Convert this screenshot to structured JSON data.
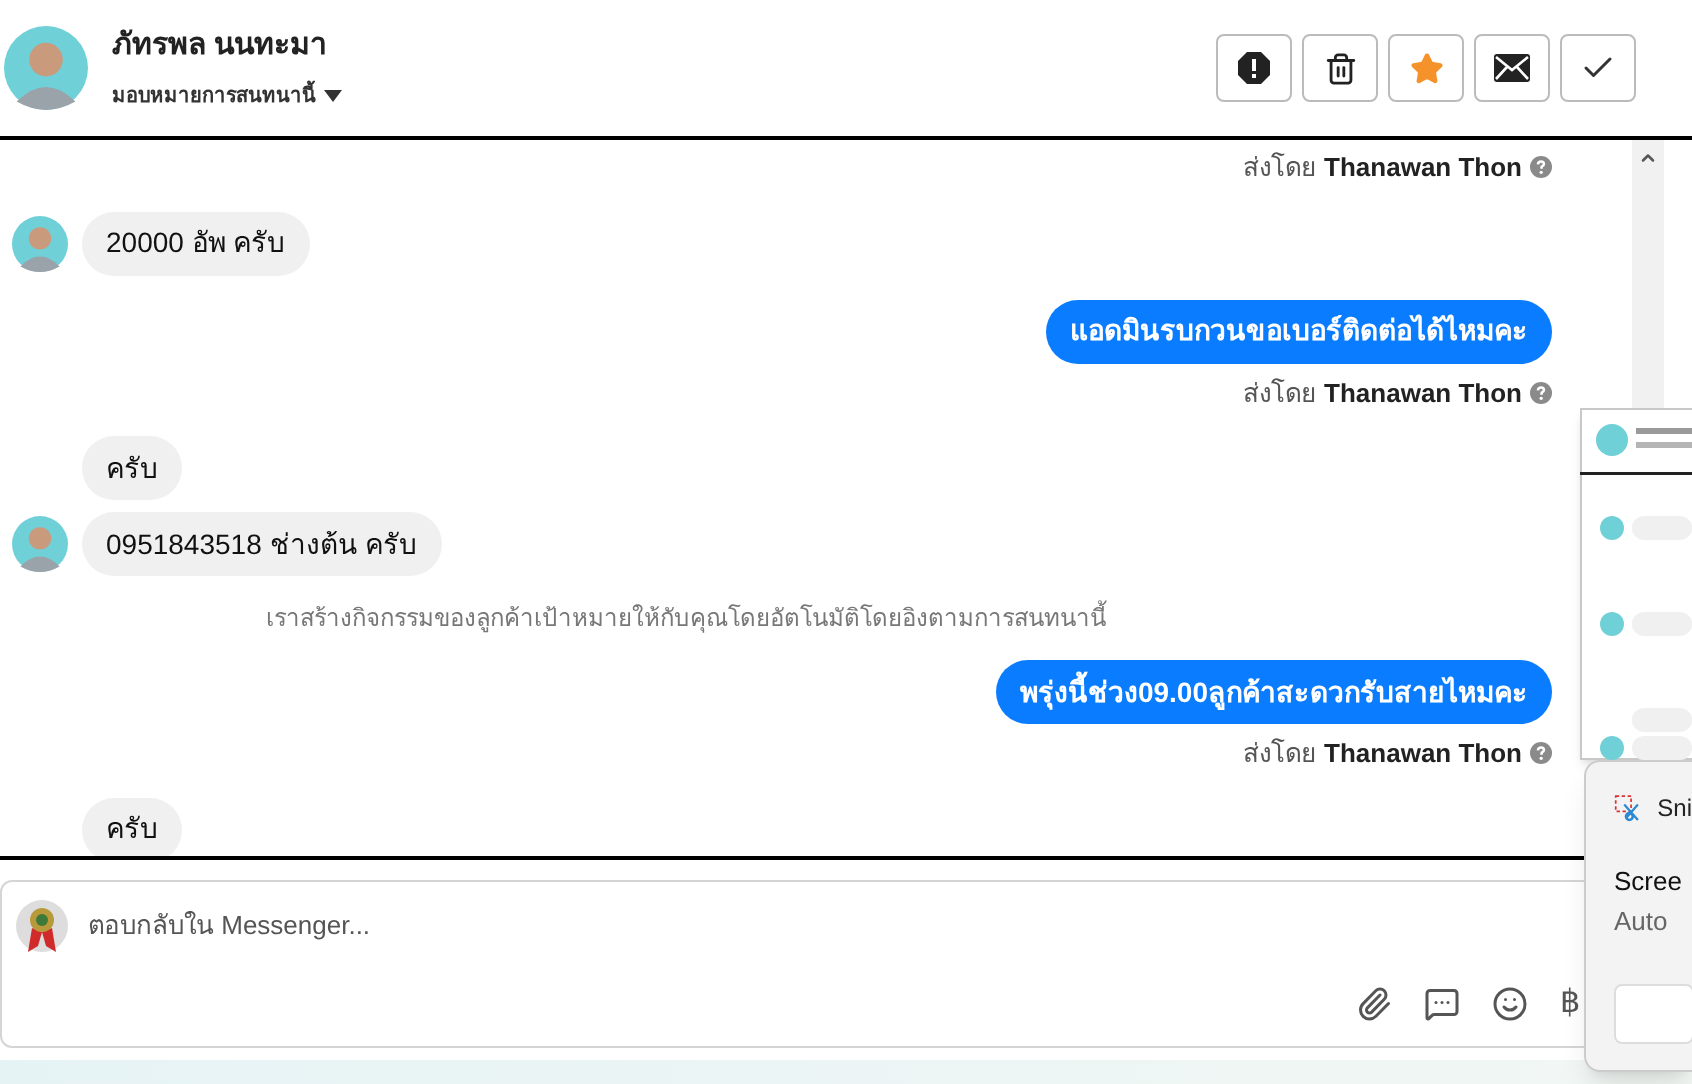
{
  "header": {
    "name": "ภัทรพล นนทะมา",
    "assign_label": "มอบหมายการสนทนานี้",
    "actions": [
      {
        "kind": "report"
      },
      {
        "kind": "delete"
      },
      {
        "kind": "star",
        "on": true
      },
      {
        "kind": "mail"
      },
      {
        "kind": "done"
      }
    ]
  },
  "messages": [
    {
      "kind": "sent_by",
      "prefix": "ส่งโดย",
      "name": "Thanawan Thon"
    },
    {
      "kind": "incoming",
      "avatar": true,
      "text": "20000 อัพ ครับ"
    },
    {
      "kind": "outgoing",
      "text": "แอดมินรบกวนขอเบอร์ติดต่อได้ไหมคะ"
    },
    {
      "kind": "sent_by",
      "prefix": "ส่งโดย",
      "name": "Thanawan Thon"
    },
    {
      "kind": "incoming",
      "avatar": false,
      "text": "ครับ"
    },
    {
      "kind": "incoming",
      "avatar": true,
      "text": "0951843518 ช่างต้น ครับ"
    },
    {
      "kind": "system",
      "text": "เราสร้างกิจกรรมของลูกค้าเป้าหมายให้กับคุณโดยอัตโนมัติโดยอิงตามการสนทนานี้"
    },
    {
      "kind": "outgoing",
      "text": "พรุ่งนี้ช่วง09.00ลูกค้าสะดวกรับสายไหมคะ"
    },
    {
      "kind": "sent_by",
      "prefix": "ส่งโดย",
      "name": "Thanawan Thon"
    },
    {
      "kind": "incoming",
      "avatar": false,
      "text": "ครับ"
    }
  ],
  "composer": {
    "placeholder": "ตอบกลับใน Messenger...",
    "currency_symbol": "฿"
  },
  "toast": {
    "app": "Sni",
    "title": "Scree",
    "body": "Auto"
  }
}
